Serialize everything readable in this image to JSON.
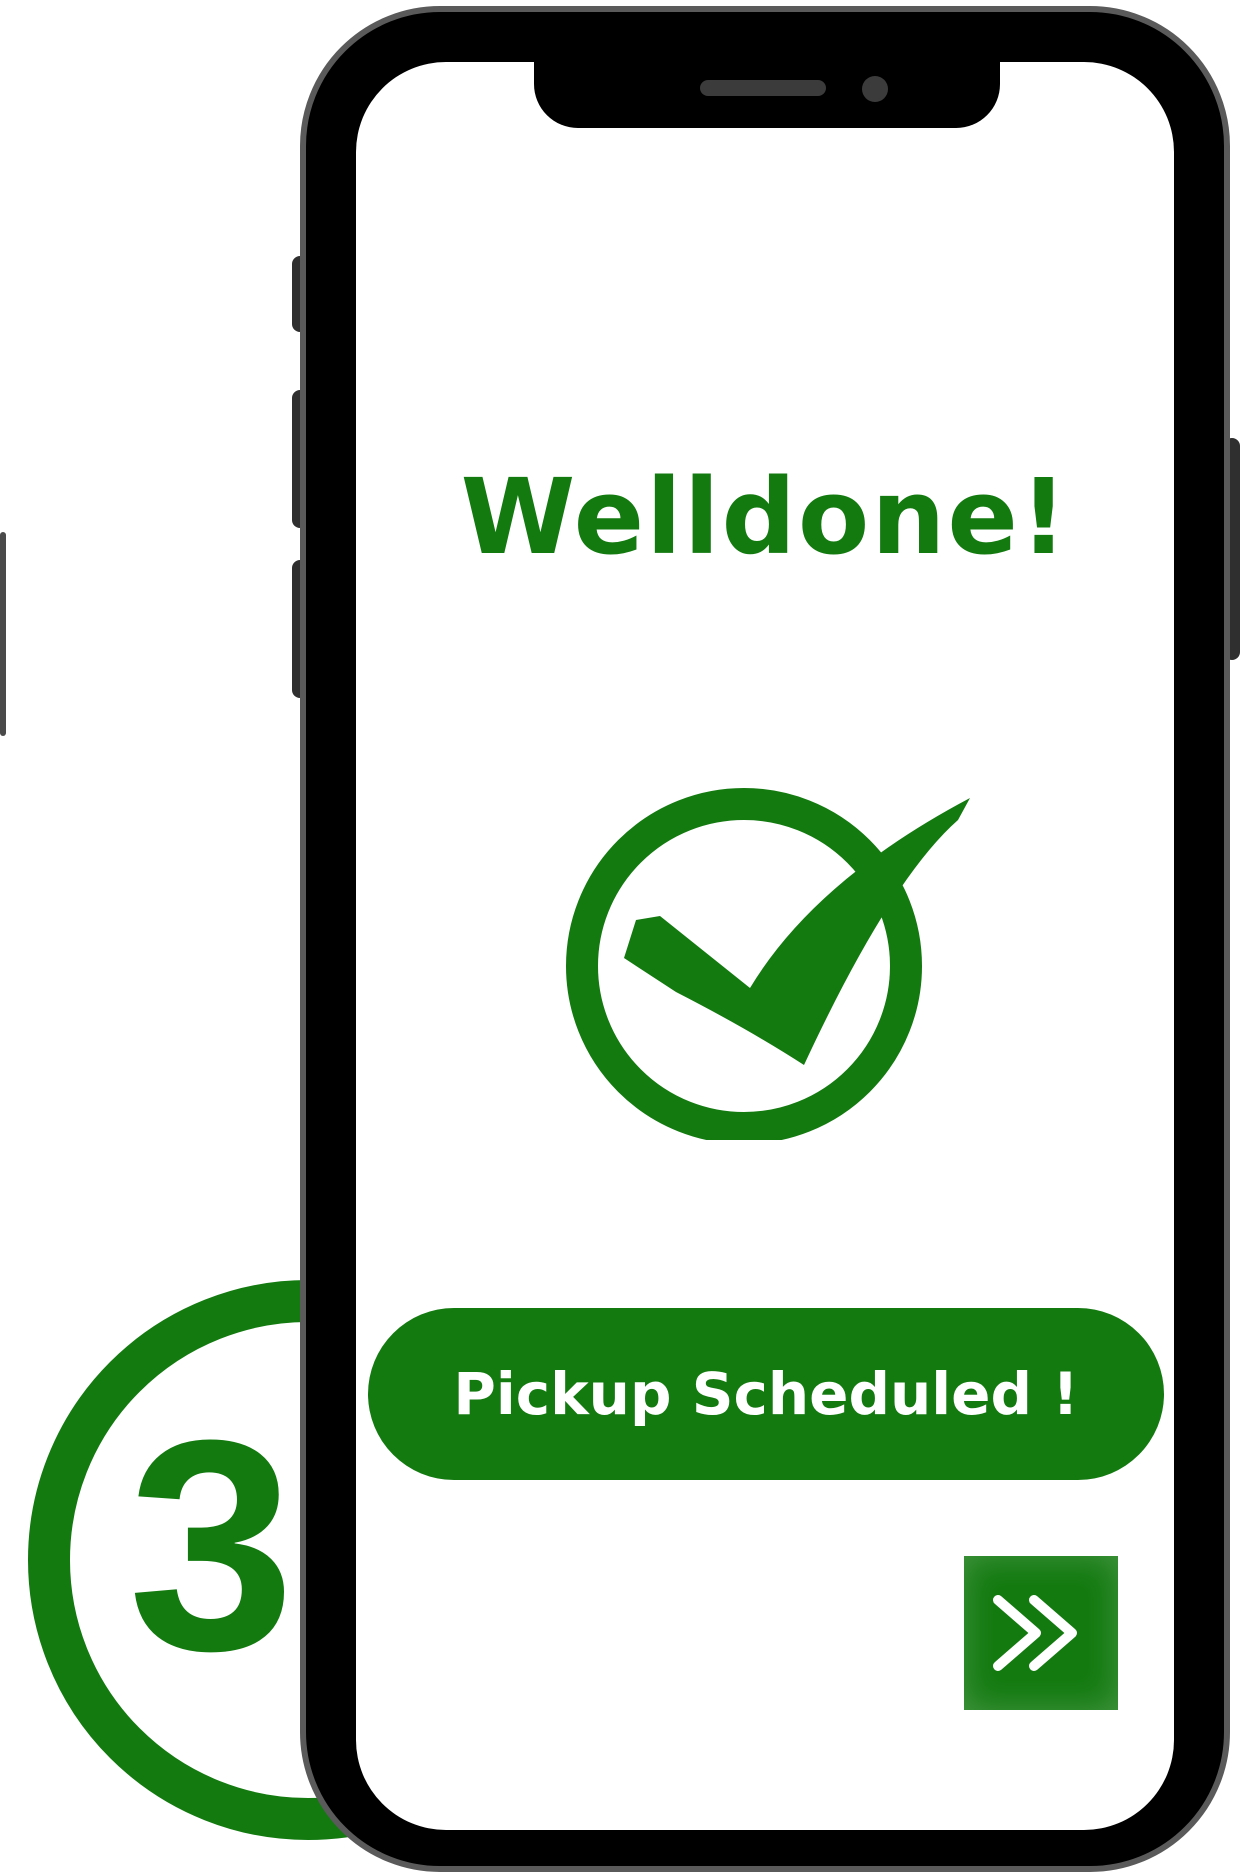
{
  "screen": {
    "title": "Welldone!",
    "status_icon": "checkmark-circle-icon",
    "primary_button_label": "Pickup Scheduled !",
    "next_button_icon": "double-chevron-right-icon"
  },
  "step_indicator": {
    "number": "3"
  },
  "theme": {
    "accent": "#137a10",
    "phone_frame": "#000000",
    "screen_background": "#ffffff",
    "text_on_accent": "#ffffff"
  }
}
